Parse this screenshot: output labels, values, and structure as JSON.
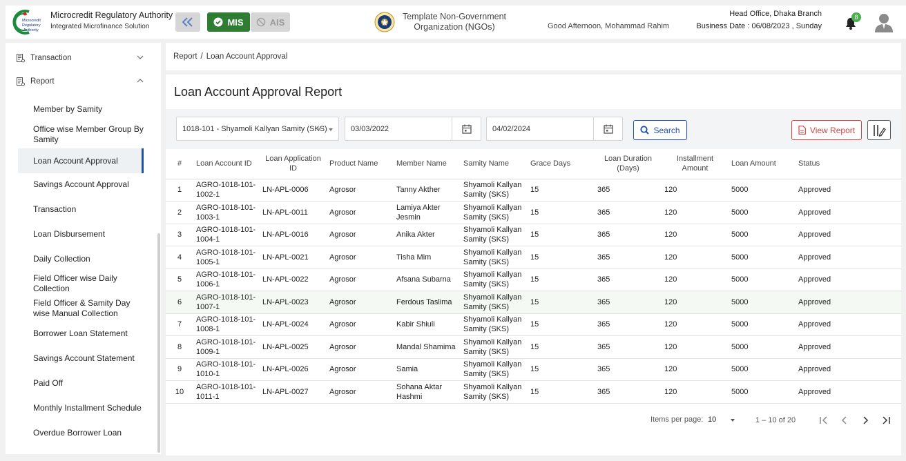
{
  "header": {
    "brand_title": "Microcredit Regulatory Authority",
    "brand_sub": "Integrated Microfinance Solution",
    "logo_text": [
      "Microcredit",
      "Regulatory",
      "Authority"
    ],
    "mis_label": "MIS",
    "ais_label": "AIS",
    "org_name_line1": "Template Non-Government",
    "org_name_line2": "Organization (NGOs)",
    "greeting": "Good Afternoon, Mohammad Rahim",
    "branch": "Head Office, Dhaka Branch",
    "business_date": "Business Date : 06/08/2023 , Sunday",
    "notification_count": "8"
  },
  "sidebar": {
    "top_items": [
      {
        "label": "Transaction",
        "expanded": false
      },
      {
        "label": "Report",
        "expanded": true
      }
    ],
    "report_items": [
      "Member by Samity",
      "Office wise Member Group By Samity",
      "Loan Account Approval",
      "Savings Account Approval",
      "Transaction",
      "Loan Disbursement",
      "Daily Collection",
      "Field Officer wise Daily Collection",
      "Field Officer & Samity Day wise Manual Collection",
      "Borrower Loan Statement",
      "Savings Account Statement",
      "Paid Off",
      "Monthly Installment Schedule",
      "Overdue Borrower Loan"
    ],
    "active_index": 2
  },
  "breadcrumb": {
    "root": "Report",
    "sep": "/",
    "current": "Loan Account Approval"
  },
  "page": {
    "title": "Loan Account Approval Report"
  },
  "filters": {
    "samity": "1018-101 - Shyamoli Kallyan Samity (SKS)",
    "from_date": "03/03/2022",
    "to_date": "04/02/2024",
    "search_label": "Search",
    "view_report_label": "View Report"
  },
  "table": {
    "columns": [
      "#",
      "Loan Account ID",
      "Loan Application ID",
      "Product Name",
      "Member Name",
      "Samity Name",
      "Grace Days",
      "Loan Duration (Days)",
      "Installment Amount",
      "Loan Amount",
      "Status"
    ],
    "rows": [
      [
        "1",
        "AGRO-1018-101-1002-1",
        "LN-APL-0006",
        "Agrosor",
        "Tanny Akther",
        "Shyamoli Kallyan Samity (SKS)",
        "15",
        "365",
        "120",
        "5000",
        "Approved"
      ],
      [
        "2",
        "AGRO-1018-101-1003-1",
        "LN-APL-0011",
        "Agrosor",
        "Lamiya Akter Jesmin",
        "Shyamoli Kallyan Samity (SKS)",
        "15",
        "365",
        "120",
        "5000",
        "Approved"
      ],
      [
        "3",
        "AGRO-1018-101-1004-1",
        "LN-APL-0016",
        "Agrosor",
        "Anika Akter",
        "Shyamoli Kallyan Samity (SKS)",
        "15",
        "365",
        "120",
        "5000",
        "Approved"
      ],
      [
        "4",
        "AGRO-1018-101-1005-1",
        "LN-APL-0021",
        "Agrosor",
        "Tisha Mim",
        "Shyamoli Kallyan Samity (SKS)",
        "15",
        "365",
        "120",
        "5000",
        "Approved"
      ],
      [
        "5",
        "AGRO-1018-101-1006-1",
        "LN-APL-0022",
        "Agrosor",
        "Afsana Subarna",
        "Shyamoli Kallyan Samity (SKS)",
        "15",
        "365",
        "120",
        "5000",
        "Approved"
      ],
      [
        "6",
        "AGRO-1018-101-1007-1",
        "LN-APL-0023",
        "Agrosor",
        "Ferdous Taslima",
        "Shyamoli Kallyan Samity (SKS)",
        "15",
        "365",
        "120",
        "5000",
        "Approved"
      ],
      [
        "7",
        "AGRO-1018-101-1008-1",
        "LN-APL-0024",
        "Agrosor",
        "Kabir Shiuli",
        "Shyamoli Kallyan Samity (SKS)",
        "15",
        "365",
        "120",
        "5000",
        "Approved"
      ],
      [
        "8",
        "AGRO-1018-101-1009-1",
        "LN-APL-0025",
        "Agrosor",
        "Mandal Shamima",
        "Shyamoli Kallyan Samity (SKS)",
        "15",
        "365",
        "120",
        "5000",
        "Approved"
      ],
      [
        "9",
        "AGRO-1018-101-1010-1",
        "LN-APL-0026",
        "Agrosor",
        "Samia",
        "Shyamoli Kallyan Samity (SKS)",
        "15",
        "365",
        "120",
        "5000",
        "Approved"
      ],
      [
        "10",
        "AGRO-1018-101-1011-1",
        "LN-APL-0027",
        "Agrosor",
        "Sohana Aktar Hashmi",
        "Shyamoli Kallyan Samity (SKS)",
        "15",
        "365",
        "120",
        "5000",
        "Approved"
      ]
    ]
  },
  "pagination": {
    "items_per_page_label": "Items per page:",
    "items_per_page": "10",
    "range": "1 – 10 of 20"
  },
  "colors": {
    "accent_green": "#2e7d32",
    "primary_blue": "#1e4fa8",
    "danger_red": "#d14343",
    "badge_green": "#4caf50"
  },
  "icons": [
    "double-chevron-left-icon",
    "check-circle-icon",
    "ban-icon",
    "bell-icon",
    "user-avatar-icon",
    "calendar-icon",
    "search-icon",
    "pdf-file-icon",
    "column-settings-icon",
    "first-page-icon",
    "prev-page-icon",
    "next-page-icon",
    "last-page-icon",
    "report-menu-icon",
    "chevron-down-icon",
    "chevron-up-icon"
  ]
}
